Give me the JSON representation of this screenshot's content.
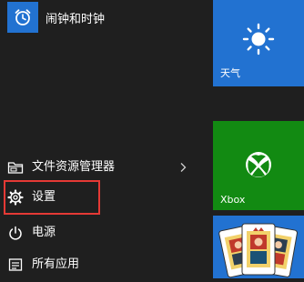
{
  "app_list": {
    "alarm_app_label": "闹钟和时钟"
  },
  "menu": {
    "file_explorer_label": "文件资源管理器",
    "settings_label": "设置",
    "power_label": "电源",
    "all_apps_label": "所有应用"
  },
  "tiles": {
    "weather_label": "天气",
    "xbox_label": "Xbox"
  },
  "colors": {
    "start_background": "#1f1f1f",
    "accent_blue": "#2272d1",
    "xbox_green": "#128a12",
    "highlight_red": "#e53935"
  },
  "icons": {
    "alarm": "alarm-clock-icon",
    "file_explorer": "folder-icon",
    "settings": "gear-icon",
    "power": "power-icon",
    "all_apps": "list-icon",
    "weather": "sun-icon",
    "xbox": "xbox-logo-icon",
    "solitaire": "playing-cards-icon"
  }
}
